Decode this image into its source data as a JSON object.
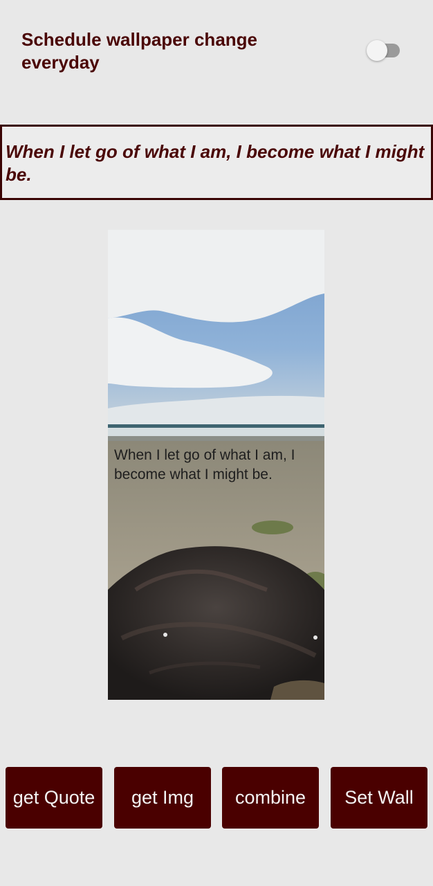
{
  "schedule": {
    "label": "Schedule wallpaper change everyday",
    "toggle_on": false
  },
  "quote": {
    "text": "When I let go of what I am, I become what I might be."
  },
  "preview": {
    "image": "beach-with-rock-photo",
    "caption": "When I let go of what I am, I become what I might be."
  },
  "buttons": {
    "get_quote": "get Quote",
    "get_img": "get Img",
    "combine": "combine",
    "set_wall": "Set Wall"
  },
  "colors": {
    "accent": "#4a0000",
    "text": "#4a0606",
    "background": "#e8e8e8"
  }
}
